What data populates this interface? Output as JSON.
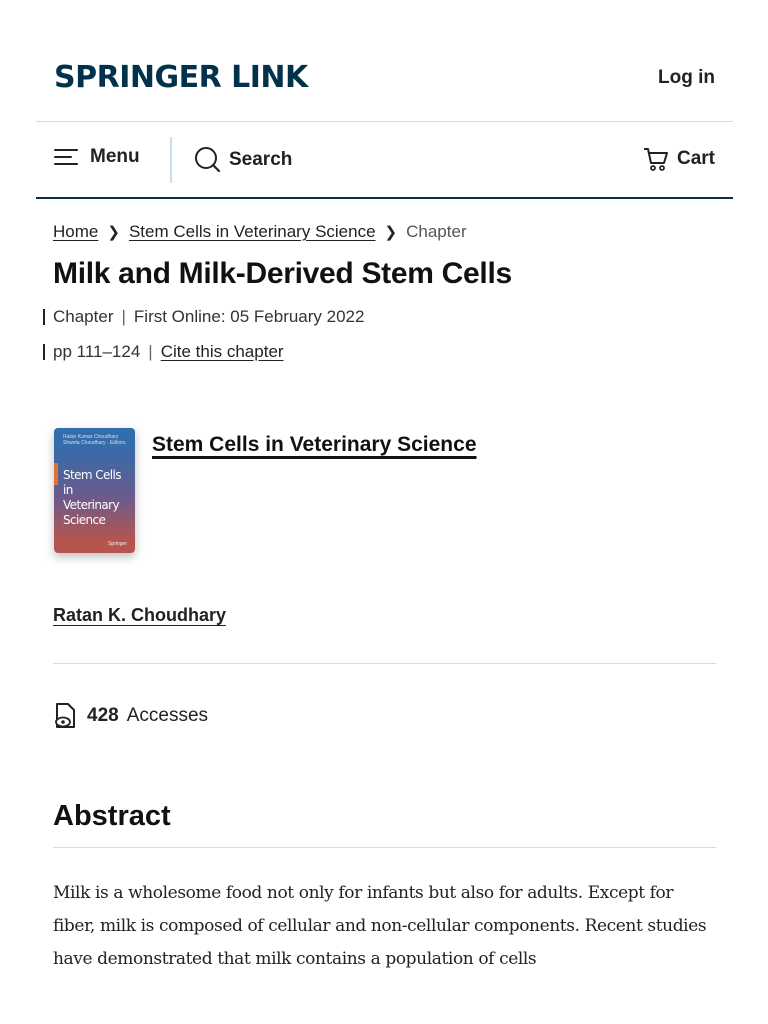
{
  "header": {
    "logo_main": "SPRINGER",
    "logo_second": "LINK",
    "login_label": "Log in"
  },
  "nav": {
    "menu_label": "Menu",
    "search_label": "Search",
    "cart_label": "Cart"
  },
  "breadcrumb": {
    "items": [
      "Home",
      "Stem Cells in Veterinary Science"
    ],
    "current": "Chapter"
  },
  "chapter": {
    "title": "Milk and Milk-Derived Stem Cells",
    "type": "Chapter",
    "first_online": "First Online: 05 February 2022",
    "pages": "pp 111–124",
    "cite_label": "Cite this chapter"
  },
  "book": {
    "title": "Stem Cells in Veterinary Science",
    "cover_authors": "Ratan Kumar Choudhary\nShweta Choudhary · Editors",
    "cover_title": "Stem Cells in Veterinary Science",
    "cover_publisher": "Springer"
  },
  "author": "Ratan K. Choudhary",
  "metrics": {
    "accesses_count": "428",
    "accesses_label": "Accesses"
  },
  "abstract": {
    "heading": "Abstract",
    "text": "Milk is a wholesome food not only for infants but also for adults. Except for fiber, milk is composed of cellular and non-cellular components. Recent studies have demonstrated that milk contains a population of cells"
  },
  "colors": {
    "brand": "#01324b",
    "divider": "#c5e0f4"
  }
}
